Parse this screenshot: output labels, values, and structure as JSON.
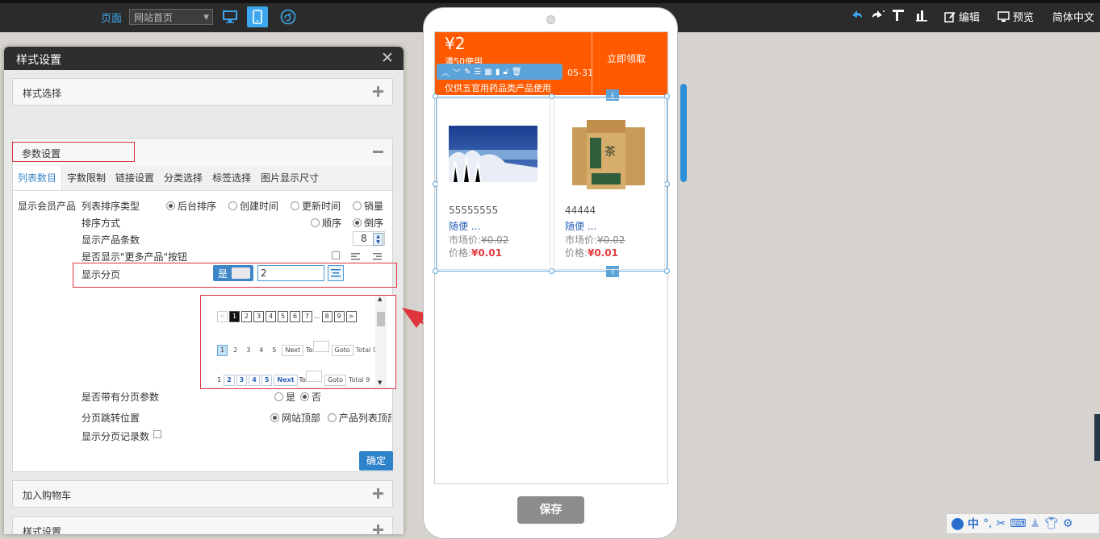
{
  "topbar": {
    "page_label": "页面",
    "page_select": "网站首页",
    "right": {
      "edit": "编辑",
      "preview": "预览",
      "language": "简体中文"
    }
  },
  "panel": {
    "title": "样式设置",
    "sections": {
      "style_select": "样式选择",
      "params": "参数设置",
      "add_cart": "加入购物车",
      "style_settings": "样式设置"
    },
    "tabs": [
      "列表数目",
      "字数限制",
      "链接设置",
      "分类选择",
      "标签选择",
      "图片显示尺寸"
    ],
    "side_label": "显示会员产品",
    "rows": {
      "sort_type": "列表排序类型",
      "sort_type_options": [
        "后台排序",
        "创建时间",
        "更新时间",
        "销量"
      ],
      "sort_order": "排序方式",
      "sort_order_options": [
        "顺序",
        "倒序"
      ],
      "count": "显示产品条数",
      "count_value": "8",
      "more_btn": "是否显示\"更多产品\"按钮",
      "paging": "显示分页",
      "paging_toggle": "是",
      "paging_value": "2",
      "page_params": "是否带有分页参数",
      "page_params_options": [
        "是",
        "否"
      ],
      "jump_pos": "分页跳转位置",
      "jump_pos_options": [
        "网站顶部",
        "产品列表顶部"
      ],
      "show_count": "显示分页记录数",
      "confirm": "确定"
    },
    "pager_styles": {
      "s1": [
        "<",
        "1",
        "2",
        "3",
        "4",
        "5",
        "6",
        "7",
        "...",
        "8",
        "9",
        ">"
      ],
      "s2": [
        "1",
        "2",
        "3",
        "4",
        "5",
        "Next",
        "To",
        "Goto",
        "Total 9"
      ],
      "s3": [
        "1",
        "2",
        "3",
        "4",
        "5",
        "Next",
        "To",
        "Goto",
        "Total 9"
      ]
    }
  },
  "phone": {
    "coupon": {
      "amount": "¥2",
      "condition": "满50使用",
      "date": "05-31",
      "desc": "仅供五官用药品类产品使用",
      "claim": "立即领取"
    },
    "products": [
      {
        "name": "55555555",
        "tag": "随便 ...",
        "market_label": "市场价:",
        "market_price": "¥0.02",
        "price_label": "价格:",
        "price": "¥0.01"
      },
      {
        "name": "44444",
        "tag": "随便 ...",
        "market_label": "市场价:",
        "market_price": "¥0.02",
        "price_label": "价格:",
        "price": "¥0.01"
      }
    ],
    "save": "保存"
  },
  "ime": {
    "lang": "中"
  },
  "colors": {
    "accent": "#3ca7f0",
    "coupon": "#ff5a00",
    "price": "#e4393c",
    "highlight": "#d9333f"
  }
}
